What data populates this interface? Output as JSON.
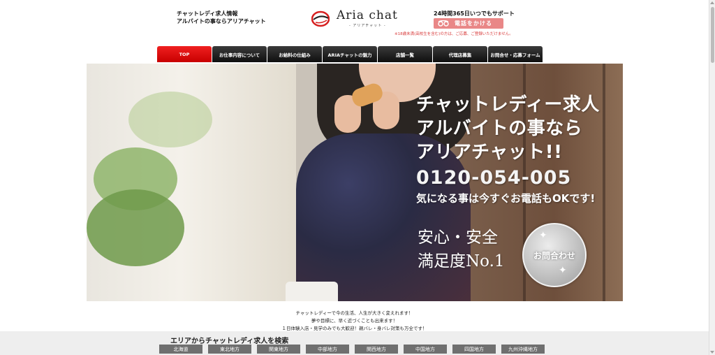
{
  "header": {
    "tagline_line1": "チャットレディ求人情報",
    "tagline_line2": "アルバイトの事ならアリアチャット",
    "logo_text": "Aria chat",
    "logo_sub": "- アリアチャット -",
    "support_text": "24時間365日いつでもサポート",
    "phone_button_label": "電話をかける",
    "notice": "※18歳未満(高校生を含む)の方は、ご応募、ご登録いただけません。"
  },
  "nav": {
    "items": [
      {
        "label": "TOP"
      },
      {
        "label": "お仕事内容について"
      },
      {
        "label": "お給料の仕組み"
      },
      {
        "label": "ARIAチャットの魅力"
      },
      {
        "label": "店舗一覧"
      },
      {
        "label": "代理店募集"
      },
      {
        "label": "お問合せ・応募フォーム"
      }
    ]
  },
  "hero": {
    "headline_line1": "チャットレディー求人",
    "headline_line2": "アルバイトの事なら",
    "headline_line3": "アリアチャット!!",
    "phone_number": "0120-054-005",
    "call_prompt": "気になる事は今すぐお電話もOKです!",
    "safety_line1": "安心・安全",
    "safety_line2": "満足度No.1",
    "contact_button": "お問合わせ"
  },
  "intro": {
    "line1": "チャットレディーで今の生活、人生が大きく変えれます！",
    "line2": "夢や目標に、早く近づくことも出来ます！",
    "line3": "１日体験入店・見学のみでも大歓迎！親バレ・身バレ対策も万全です！"
  },
  "area_search": {
    "title": "エリアからチャットレディ求人を検索",
    "regions": [
      {
        "label": "北海道"
      },
      {
        "label": "東北地方"
      },
      {
        "label": "関東地方"
      },
      {
        "label": "中部地方"
      },
      {
        "label": "関西地方"
      },
      {
        "label": "中国地方"
      },
      {
        "label": "四国地方"
      },
      {
        "label": "九州沖縄地方"
      }
    ]
  },
  "colors": {
    "nav_active": "#e00000",
    "nav_default": "#1a1a1a",
    "phone_button": "#e98787",
    "notice": "#d83a3a",
    "area_tab": "#6f6f6f"
  },
  "icons": {
    "phone": "phone-icon",
    "logo_mark": "logo-swoosh-icon"
  }
}
